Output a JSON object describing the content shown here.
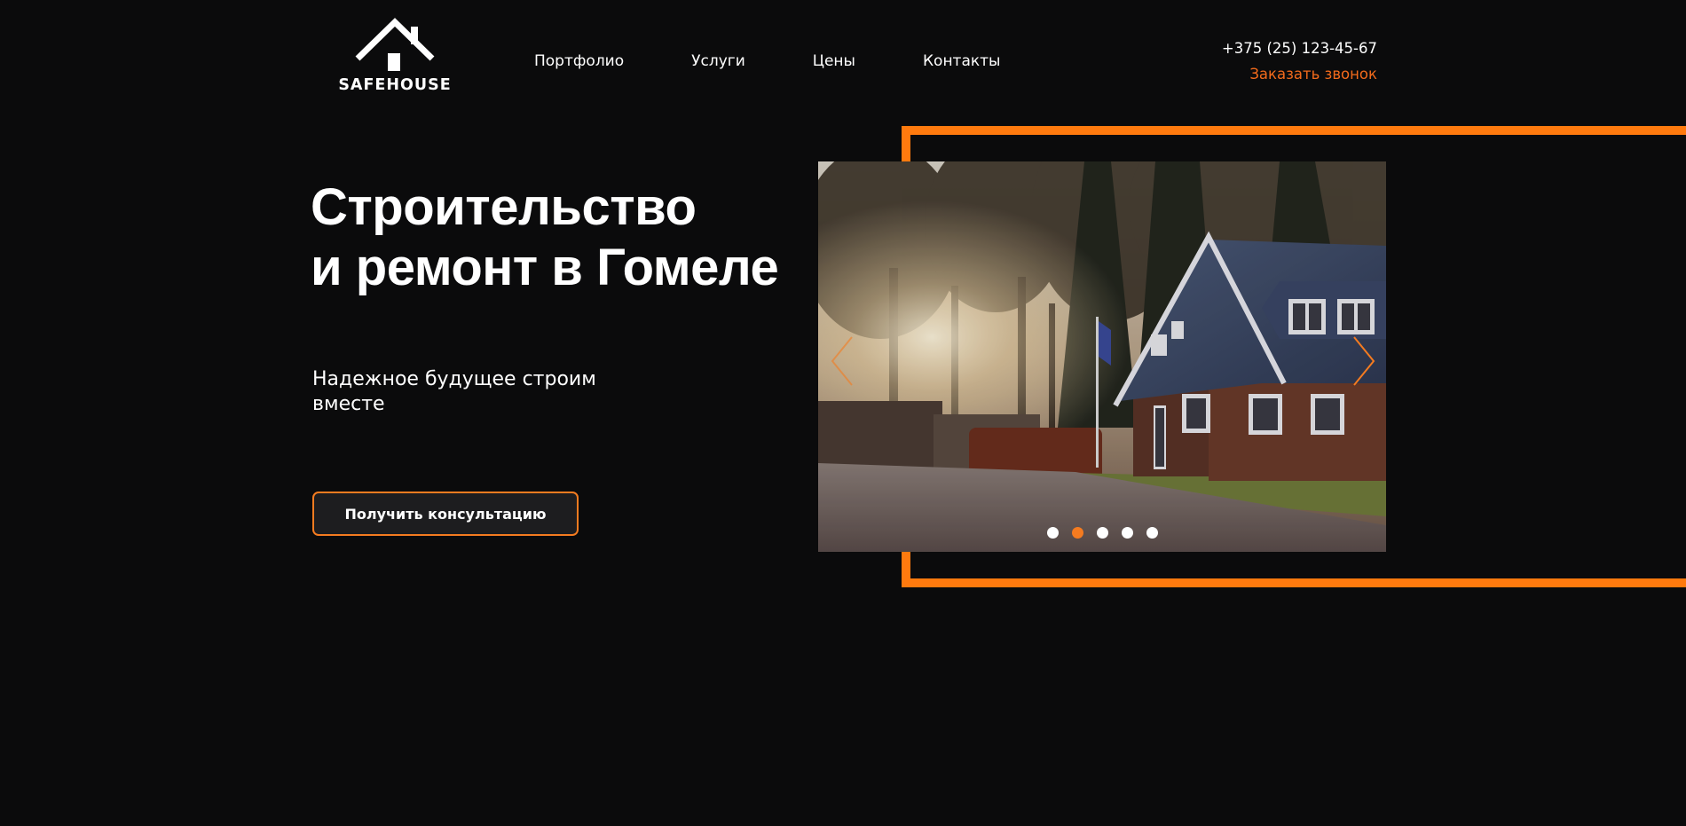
{
  "header": {
    "logo_text": "SAFEHOUSE",
    "nav": [
      {
        "label": "Портфолио"
      },
      {
        "label": "Услуги"
      },
      {
        "label": "Цены"
      },
      {
        "label": "Контакты"
      }
    ],
    "phone": "+375 (25) 123-45-67",
    "callback_label": "Заказать звонок"
  },
  "hero": {
    "title_line1": "Строительство",
    "title_line2": "и ремонт в Гомеле",
    "subtitle": "Надежное будущее строим вместе",
    "cta_label": "Получить консультацию"
  },
  "slider": {
    "total_slides": 5,
    "active_slide": 2,
    "prev_icon": "chevron-left-icon",
    "next_icon": "chevron-right-icon"
  },
  "colors": {
    "background": "#0b0b0c",
    "accent": "#ff7a0e",
    "text": "#ffffff"
  }
}
